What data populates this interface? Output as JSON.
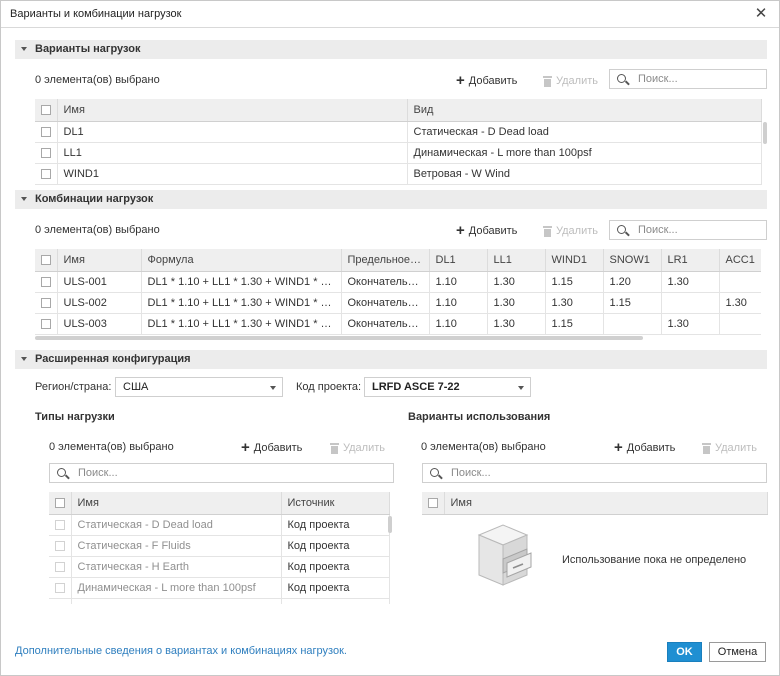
{
  "window": {
    "title": "Варианты и комбинации нагрузок",
    "close_glyph": "✕"
  },
  "load_cases": {
    "section_title": "Варианты нагрузок",
    "selected_text": "0 элемента(ов) выбрано",
    "add_label": "Добавить",
    "delete_label": "Удалить",
    "search_placeholder": "Поиск...",
    "columns": [
      "Имя",
      "Вид"
    ],
    "rows": [
      {
        "name": "DL1",
        "type": "Статическая - D Dead load"
      },
      {
        "name": "LL1",
        "type": "Динамическая - L more than 100psf"
      },
      {
        "name": "WIND1",
        "type": "Ветровая - W Wind"
      }
    ]
  },
  "load_combinations": {
    "section_title": "Комбинации нагрузок",
    "selected_text": "0 элемента(ов) выбрано",
    "add_label": "Добавить",
    "delete_label": "Удалить",
    "search_placeholder": "Поиск...",
    "columns": [
      "Имя",
      "Формула",
      "Предельное С...",
      "DL1",
      "LL1",
      "WIND1",
      "SNOW1",
      "LR1",
      "ACC1"
    ],
    "rows": [
      [
        "ULS-001",
        "DL1 * 1.10 + LL1 * 1.30 + WIND1 * 1.15 + ...",
        "Окончательн...",
        "1.10",
        "1.30",
        "1.15",
        "1.20",
        "1.30",
        ""
      ],
      [
        "ULS-002",
        "DL1 * 1.10 + LL1 * 1.30 + WIND1 * 1.30 + ...",
        "Окончательн...",
        "1.10",
        "1.30",
        "1.30",
        "1.15",
        "",
        "1.30"
      ],
      [
        "ULS-003",
        "DL1 * 1.10 + LL1 * 1.30 + WIND1 * 1.15 + ...",
        "Окончательн...",
        "1.10",
        "1.30",
        "1.15",
        "",
        "1.30",
        ""
      ]
    ]
  },
  "advanced": {
    "section_title": "Расширенная конфигурация",
    "region_label": "Регион/страна:",
    "region_value": "США",
    "code_label": "Код проекта:",
    "code_value": "LRFD ASCE 7-22",
    "load_types": {
      "title": "Типы нагрузки",
      "selected_text": "0 элемента(ов) выбрано",
      "add_label": "Добавить",
      "delete_label": "Удалить",
      "search_placeholder": "Поиск...",
      "columns": [
        "Имя",
        "Источник"
      ],
      "rows": [
        {
          "name": "Статическая - D Dead load",
          "source": "Код проекта"
        },
        {
          "name": "Статическая - F Fluids",
          "source": "Код проекта"
        },
        {
          "name": "Статическая - H Earth",
          "source": "Код проекта"
        },
        {
          "name": "Динамическая - L more than 100psf",
          "source": "Код проекта"
        }
      ]
    },
    "usage_cases": {
      "title": "Варианты использования",
      "selected_text": "0 элемента(ов) выбрано",
      "add_label": "Добавить",
      "delete_label": "Удалить",
      "search_placeholder": "Поиск...",
      "columns": [
        "Имя"
      ],
      "empty_text": "Использование пока не определено",
      "empty_icon": "file-cabinet-icon"
    }
  },
  "footer": {
    "help_link": "Дополнительные сведения о вариантах и комбинациях нагрузок.",
    "ok_label": "OK",
    "cancel_label": "Отмена"
  },
  "colors": {
    "accent": "#1f8fd2",
    "link": "#2f7fbf",
    "section_bg": "#ececec"
  }
}
